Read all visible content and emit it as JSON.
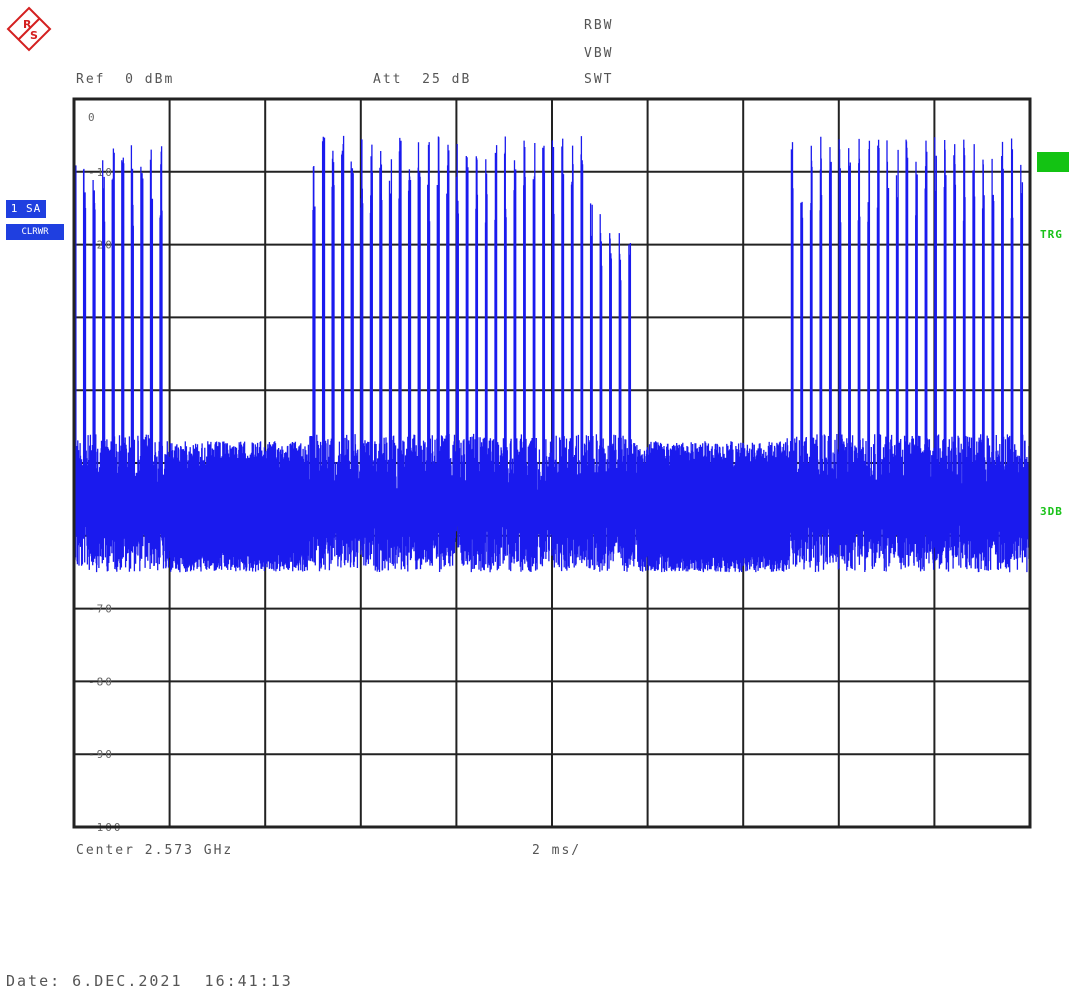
{
  "header": {
    "rbw_label": "RBW",
    "vbw_label": "VBW",
    "swt_label": "SWT",
    "ref_label": "Ref  0 dBm",
    "att_label": "Att  25 dB"
  },
  "side": {
    "trace_tag": "1 SA",
    "trace_mode": "CLRWR",
    "trig_label": "TRG",
    "threshold_label": "3DB"
  },
  "footer": {
    "center_label": "Center 2.573 GHz",
    "span_label": "2 ms/",
    "date_label": "Date: 6.DEC.2021  16:41:13"
  },
  "chart_data": {
    "type": "line",
    "title": "",
    "xlabel": "",
    "ylabel": "",
    "ylim": [
      -100,
      0
    ],
    "x_divisions": 10,
    "y_tick_labels": [
      "0",
      "-10",
      "-20",
      "",
      "",
      "",
      "",
      "-70",
      "-80",
      "-90",
      "-100"
    ],
    "y_tick_values": [
      0,
      -10,
      -20,
      -30,
      -40,
      -50,
      -60,
      -70,
      -80,
      -90,
      -100
    ],
    "grid": true,
    "trace_color": "#1a1aee",
    "bursts": [
      {
        "start_div": 0.0,
        "end_div": 0.95,
        "peak_dbm": -14,
        "floor_dbm": -52
      },
      {
        "start_div": 2.45,
        "end_div": 5.35,
        "peak_dbm": -13,
        "floor_dbm": -52
      },
      {
        "start_div": 5.35,
        "end_div": 5.9,
        "peak_dbm": -22,
        "floor_dbm": -55
      },
      {
        "start_div": 7.45,
        "end_div": 10.0,
        "peak_dbm": -13,
        "floor_dbm": -52
      }
    ],
    "noise_segments": [
      {
        "start_div": 0.95,
        "end_div": 2.45,
        "top_dbm": -47,
        "bottom_dbm": -62
      },
      {
        "start_div": 5.9,
        "end_div": 7.45,
        "top_dbm": -47,
        "bottom_dbm": -62
      }
    ]
  }
}
